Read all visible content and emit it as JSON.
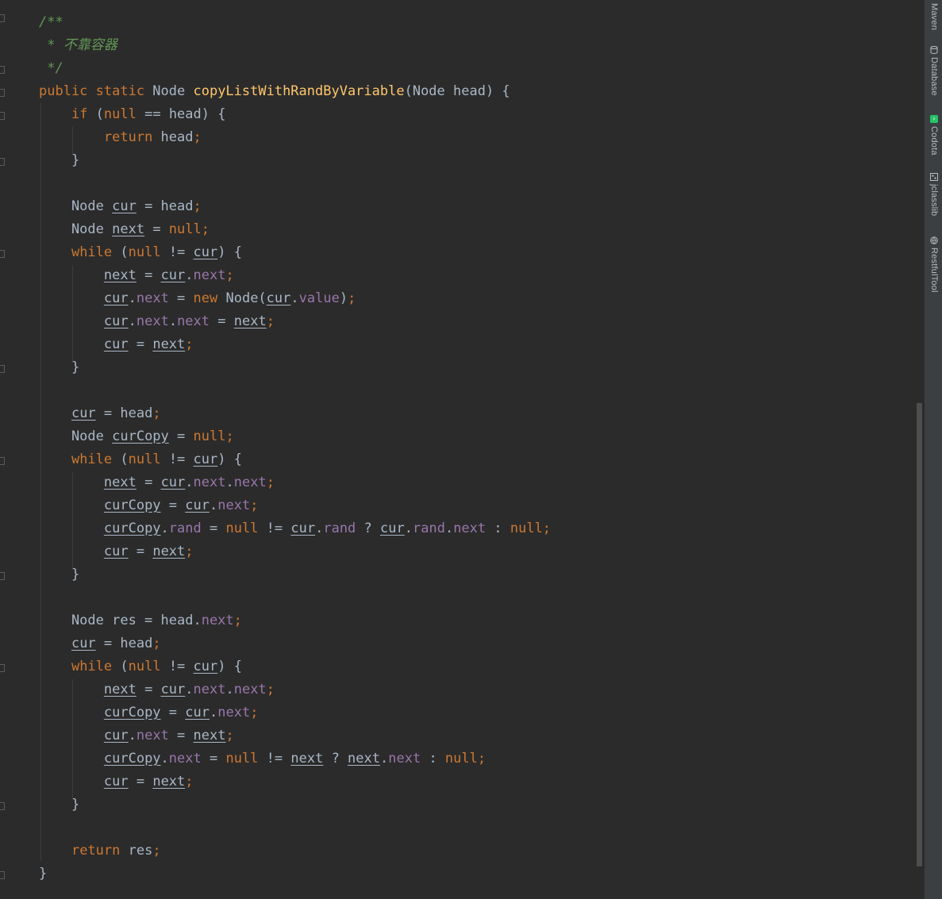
{
  "editor": {
    "lines": [
      [
        {
          "t": "/**",
          "c": "cm"
        }
      ],
      [
        {
          "t": " * 不靠容器",
          "c": "cm"
        }
      ],
      [
        {
          "t": " */",
          "c": "cm"
        }
      ],
      [
        {
          "t": "public static ",
          "c": "kw"
        },
        {
          "t": "Node ",
          "c": "plain"
        },
        {
          "t": "copyListWithRandByVariable",
          "c": "fn"
        },
        {
          "t": "(Node head) {",
          "c": "plain"
        }
      ],
      [
        {
          "t": "    ",
          "c": "plain"
        },
        {
          "t": "if ",
          "c": "kw"
        },
        {
          "t": "(",
          "c": "plain"
        },
        {
          "t": "null ",
          "c": "kw"
        },
        {
          "t": "== head) {",
          "c": "plain"
        }
      ],
      [
        {
          "t": "        ",
          "c": "plain"
        },
        {
          "t": "return ",
          "c": "kw"
        },
        {
          "t": "head",
          "c": "plain"
        },
        {
          "t": ";",
          "c": "kw"
        }
      ],
      [
        {
          "t": "    }",
          "c": "plain"
        }
      ],
      [],
      [
        {
          "t": "    Node ",
          "c": "plain"
        },
        {
          "t": "cur",
          "c": "var"
        },
        {
          "t": " = head",
          "c": "plain"
        },
        {
          "t": ";",
          "c": "kw"
        }
      ],
      [
        {
          "t": "    Node ",
          "c": "plain"
        },
        {
          "t": "next",
          "c": "var"
        },
        {
          "t": " = ",
          "c": "plain"
        },
        {
          "t": "null;",
          "c": "kw"
        }
      ],
      [
        {
          "t": "    ",
          "c": "plain"
        },
        {
          "t": "while ",
          "c": "kw"
        },
        {
          "t": "(",
          "c": "plain"
        },
        {
          "t": "null ",
          "c": "kw"
        },
        {
          "t": "!= ",
          "c": "plain"
        },
        {
          "t": "cur",
          "c": "var"
        },
        {
          "t": ") {",
          "c": "plain"
        }
      ],
      [
        {
          "t": "        ",
          "c": "plain"
        },
        {
          "t": "next",
          "c": "var"
        },
        {
          "t": " = ",
          "c": "plain"
        },
        {
          "t": "cur",
          "c": "var"
        },
        {
          "t": ".",
          "c": "plain"
        },
        {
          "t": "next",
          "c": "fld"
        },
        {
          "t": ";",
          "c": "kw"
        }
      ],
      [
        {
          "t": "        ",
          "c": "plain"
        },
        {
          "t": "cur",
          "c": "var"
        },
        {
          "t": ".",
          "c": "plain"
        },
        {
          "t": "next",
          "c": "fld"
        },
        {
          "t": " = ",
          "c": "plain"
        },
        {
          "t": "new ",
          "c": "kw"
        },
        {
          "t": "Node(",
          "c": "plain"
        },
        {
          "t": "cur",
          "c": "var"
        },
        {
          "t": ".",
          "c": "plain"
        },
        {
          "t": "value",
          "c": "fld"
        },
        {
          "t": ")",
          "c": "plain"
        },
        {
          "t": ";",
          "c": "kw"
        }
      ],
      [
        {
          "t": "        ",
          "c": "plain"
        },
        {
          "t": "cur",
          "c": "var"
        },
        {
          "t": ".",
          "c": "plain"
        },
        {
          "t": "next",
          "c": "fld"
        },
        {
          "t": ".",
          "c": "plain"
        },
        {
          "t": "next",
          "c": "fld"
        },
        {
          "t": " = ",
          "c": "plain"
        },
        {
          "t": "next",
          "c": "var"
        },
        {
          "t": ";",
          "c": "kw"
        }
      ],
      [
        {
          "t": "        ",
          "c": "plain"
        },
        {
          "t": "cur",
          "c": "var"
        },
        {
          "t": " = ",
          "c": "plain"
        },
        {
          "t": "next",
          "c": "var"
        },
        {
          "t": ";",
          "c": "kw"
        }
      ],
      [
        {
          "t": "    }",
          "c": "plain"
        }
      ],
      [],
      [
        {
          "t": "    ",
          "c": "plain"
        },
        {
          "t": "cur",
          "c": "var"
        },
        {
          "t": " = head",
          "c": "plain"
        },
        {
          "t": ";",
          "c": "kw"
        }
      ],
      [
        {
          "t": "    Node ",
          "c": "plain"
        },
        {
          "t": "curCopy",
          "c": "var"
        },
        {
          "t": " = ",
          "c": "plain"
        },
        {
          "t": "null;",
          "c": "kw"
        }
      ],
      [
        {
          "t": "    ",
          "c": "plain"
        },
        {
          "t": "while ",
          "c": "kw"
        },
        {
          "t": "(",
          "c": "plain"
        },
        {
          "t": "null ",
          "c": "kw"
        },
        {
          "t": "!= ",
          "c": "plain"
        },
        {
          "t": "cur",
          "c": "var"
        },
        {
          "t": ") {",
          "c": "plain"
        }
      ],
      [
        {
          "t": "        ",
          "c": "plain"
        },
        {
          "t": "next",
          "c": "var"
        },
        {
          "t": " = ",
          "c": "plain"
        },
        {
          "t": "cur",
          "c": "var"
        },
        {
          "t": ".",
          "c": "plain"
        },
        {
          "t": "next",
          "c": "fld"
        },
        {
          "t": ".",
          "c": "plain"
        },
        {
          "t": "next",
          "c": "fld"
        },
        {
          "t": ";",
          "c": "kw"
        }
      ],
      [
        {
          "t": "        ",
          "c": "plain"
        },
        {
          "t": "curCopy",
          "c": "var"
        },
        {
          "t": " = ",
          "c": "plain"
        },
        {
          "t": "cur",
          "c": "var"
        },
        {
          "t": ".",
          "c": "plain"
        },
        {
          "t": "next",
          "c": "fld"
        },
        {
          "t": ";",
          "c": "kw"
        }
      ],
      [
        {
          "t": "        ",
          "c": "plain"
        },
        {
          "t": "curCopy",
          "c": "var"
        },
        {
          "t": ".",
          "c": "plain"
        },
        {
          "t": "rand",
          "c": "fld"
        },
        {
          "t": " = ",
          "c": "plain"
        },
        {
          "t": "null ",
          "c": "kw"
        },
        {
          "t": "!= ",
          "c": "plain"
        },
        {
          "t": "cur",
          "c": "var"
        },
        {
          "t": ".",
          "c": "plain"
        },
        {
          "t": "rand",
          "c": "fld"
        },
        {
          "t": " ? ",
          "c": "plain"
        },
        {
          "t": "cur",
          "c": "var"
        },
        {
          "t": ".",
          "c": "plain"
        },
        {
          "t": "rand",
          "c": "fld"
        },
        {
          "t": ".",
          "c": "plain"
        },
        {
          "t": "next",
          "c": "fld"
        },
        {
          "t": " : ",
          "c": "plain"
        },
        {
          "t": "null;",
          "c": "kw"
        }
      ],
      [
        {
          "t": "        ",
          "c": "plain"
        },
        {
          "t": "cur",
          "c": "var"
        },
        {
          "t": " = ",
          "c": "plain"
        },
        {
          "t": "next",
          "c": "var"
        },
        {
          "t": ";",
          "c": "kw"
        }
      ],
      [
        {
          "t": "    }",
          "c": "plain"
        }
      ],
      [],
      [
        {
          "t": "    Node res = head.",
          "c": "plain"
        },
        {
          "t": "next",
          "c": "fld"
        },
        {
          "t": ";",
          "c": "kw"
        }
      ],
      [
        {
          "t": "    ",
          "c": "plain"
        },
        {
          "t": "cur",
          "c": "var"
        },
        {
          "t": " = head",
          "c": "plain"
        },
        {
          "t": ";",
          "c": "kw"
        }
      ],
      [
        {
          "t": "    ",
          "c": "plain"
        },
        {
          "t": "while ",
          "c": "kw"
        },
        {
          "t": "(",
          "c": "plain"
        },
        {
          "t": "null ",
          "c": "kw"
        },
        {
          "t": "!= ",
          "c": "plain"
        },
        {
          "t": "cur",
          "c": "var"
        },
        {
          "t": ") {",
          "c": "plain"
        }
      ],
      [
        {
          "t": "        ",
          "c": "plain"
        },
        {
          "t": "next",
          "c": "var"
        },
        {
          "t": " = ",
          "c": "plain"
        },
        {
          "t": "cur",
          "c": "var"
        },
        {
          "t": ".",
          "c": "plain"
        },
        {
          "t": "next",
          "c": "fld"
        },
        {
          "t": ".",
          "c": "plain"
        },
        {
          "t": "next",
          "c": "fld"
        },
        {
          "t": ";",
          "c": "kw"
        }
      ],
      [
        {
          "t": "        ",
          "c": "plain"
        },
        {
          "t": "curCopy",
          "c": "var"
        },
        {
          "t": " = ",
          "c": "plain"
        },
        {
          "t": "cur",
          "c": "var"
        },
        {
          "t": ".",
          "c": "plain"
        },
        {
          "t": "next",
          "c": "fld"
        },
        {
          "t": ";",
          "c": "kw"
        }
      ],
      [
        {
          "t": "        ",
          "c": "plain"
        },
        {
          "t": "cur",
          "c": "var"
        },
        {
          "t": ".",
          "c": "plain"
        },
        {
          "t": "next",
          "c": "fld"
        },
        {
          "t": " = ",
          "c": "plain"
        },
        {
          "t": "next",
          "c": "var"
        },
        {
          "t": ";",
          "c": "kw"
        }
      ],
      [
        {
          "t": "        ",
          "c": "plain"
        },
        {
          "t": "curCopy",
          "c": "var"
        },
        {
          "t": ".",
          "c": "plain"
        },
        {
          "t": "next",
          "c": "fld"
        },
        {
          "t": " = ",
          "c": "plain"
        },
        {
          "t": "null ",
          "c": "kw"
        },
        {
          "t": "!= ",
          "c": "plain"
        },
        {
          "t": "next",
          "c": "var"
        },
        {
          "t": " ? ",
          "c": "plain"
        },
        {
          "t": "next",
          "c": "var"
        },
        {
          "t": ".",
          "c": "plain"
        },
        {
          "t": "next",
          "c": "fld"
        },
        {
          "t": " : ",
          "c": "plain"
        },
        {
          "t": "null;",
          "c": "kw"
        }
      ],
      [
        {
          "t": "        ",
          "c": "plain"
        },
        {
          "t": "cur",
          "c": "var"
        },
        {
          "t": " = ",
          "c": "plain"
        },
        {
          "t": "next",
          "c": "var"
        },
        {
          "t": ";",
          "c": "kw"
        }
      ],
      [
        {
          "t": "    }",
          "c": "plain"
        }
      ],
      [],
      [
        {
          "t": "    ",
          "c": "plain"
        },
        {
          "t": "return ",
          "c": "kw"
        },
        {
          "t": "res",
          "c": "plain"
        },
        {
          "t": ";",
          "c": "kw"
        }
      ],
      [
        {
          "t": "}",
          "c": "plain"
        }
      ]
    ]
  },
  "colors": {
    "background": "#2b2b2b",
    "keyword": "#cc7832",
    "comment": "#629755",
    "method": "#ffc66d",
    "field": "#9876aa",
    "text": "#a9b7c6"
  },
  "side_tabs": [
    {
      "label": "Maven",
      "icon": "maven-icon"
    },
    {
      "label": "Database",
      "icon": "database-icon"
    },
    {
      "label": "Codota",
      "icon": "codota-icon"
    },
    {
      "label": "jclasslib",
      "icon": "jclasslib-icon"
    },
    {
      "label": "RestfulTool",
      "icon": "globe-icon"
    }
  ]
}
